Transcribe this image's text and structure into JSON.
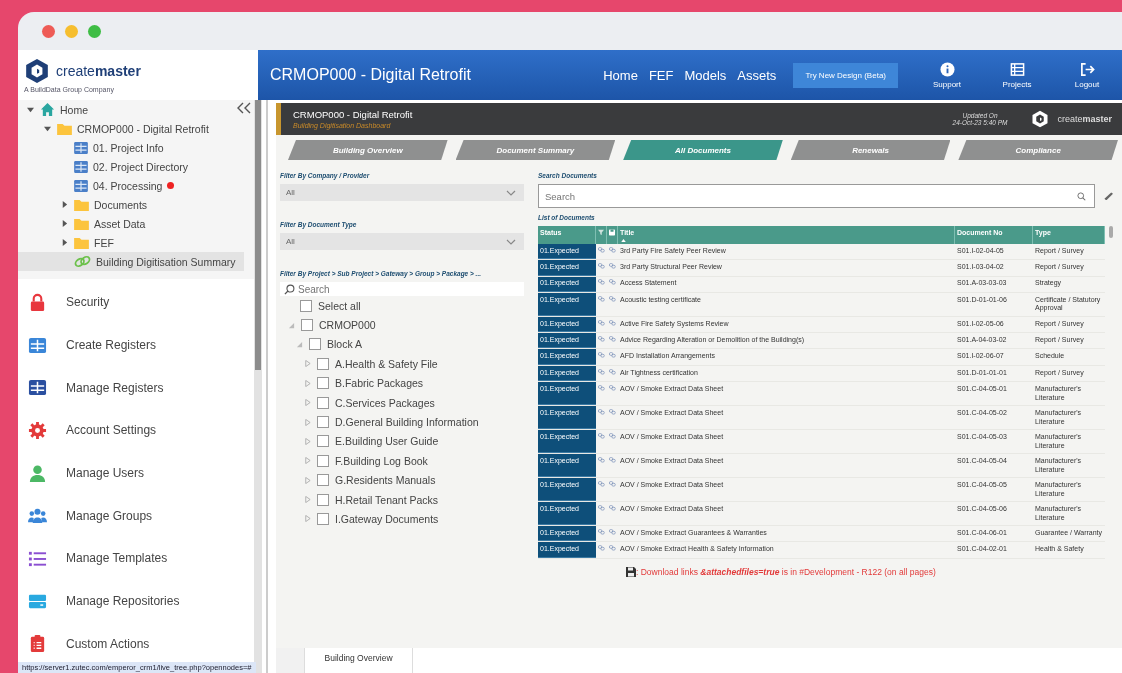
{
  "brand": {
    "logo": "create**master**",
    "tagline": "A BuildData Group Company"
  },
  "header": {
    "title": "CRMOP000 - Digital Retrofit",
    "nav": [
      "Home",
      "FEF",
      "Models",
      "Assets"
    ],
    "beta_button": "Try New Design (Beta)",
    "actions": [
      {
        "kind": "support",
        "label": "Support"
      },
      {
        "kind": "projects",
        "label": "Projects"
      },
      {
        "kind": "logout",
        "label": "Logout"
      }
    ]
  },
  "sidebar": {
    "tree": [
      {
        "kind": "home",
        "label": "Home",
        "expanded": true,
        "selected": false,
        "flagged": false,
        "children": [
          {
            "kind": "folder",
            "label": "CRMOP000 - Digital Retrofit",
            "expanded": true,
            "selected": false,
            "flagged": false,
            "children": [
              {
                "kind": "grid",
                "label": "01. Project Info",
                "selected": false,
                "flagged": false
              },
              {
                "kind": "grid",
                "label": "02. Project Directory",
                "selected": false,
                "flagged": false
              },
              {
                "kind": "grid",
                "label": "04. Processing",
                "selected": false,
                "flagged": true
              },
              {
                "kind": "folder",
                "label": "Documents",
                "expanded": false,
                "selected": false,
                "flagged": false
              },
              {
                "kind": "folder",
                "label": "Asset Data",
                "expanded": false,
                "selected": false,
                "flagged": false
              },
              {
                "kind": "folder",
                "label": "FEF",
                "expanded": false,
                "selected": false,
                "flagged": false
              },
              {
                "kind": "link",
                "label": "Building Digitisation Summary",
                "selected": true,
                "flagged": false
              }
            ]
          }
        ]
      }
    ],
    "menu": [
      {
        "kind": "security",
        "label": "Security"
      },
      {
        "kind": "create",
        "label": "Create Registers"
      },
      {
        "kind": "manage",
        "label": "Manage Registers"
      },
      {
        "kind": "settings",
        "label": "Account Settings"
      },
      {
        "kind": "user",
        "label": "Manage Users"
      },
      {
        "kind": "group",
        "label": "Manage Groups"
      },
      {
        "kind": "template",
        "label": "Manage Templates"
      },
      {
        "kind": "repository",
        "label": "Manage Repositories"
      },
      {
        "kind": "action",
        "label": "Custom Actions"
      }
    ]
  },
  "dashboard": {
    "title": "CRMOP000 - Digital Retrofit",
    "subtitle": "Building Digitisation Dashboard",
    "updated_label": "Updated On",
    "updated": "24-Oct-23 5:40 PM",
    "logo": "create**master**",
    "tabs": [
      {
        "label": "Building Overview",
        "selected": false
      },
      {
        "label": "Document Summary",
        "selected": false
      },
      {
        "label": "All Documents",
        "selected": true
      },
      {
        "label": "Renewals",
        "selected": false
      },
      {
        "label": "Compliance",
        "selected": false
      }
    ]
  },
  "filters": [
    {
      "label": "Filter By Company / Provider",
      "value": "All"
    },
    {
      "label": "Filter By Document Type",
      "value": "All"
    }
  ],
  "project_filter": {
    "label": "Filter By Project > Sub Project > Gateway > Group > Package > ...",
    "placeholder": "Search",
    "select_all": {
      "label": "Select all",
      "checked": false
    },
    "tree": [
      {
        "label": "CRMOP000",
        "checked": false,
        "expanded": true,
        "children": [
          {
            "label": "Block A",
            "checked": false,
            "expanded": true,
            "children": [
              {
                "label": "A.Health & Safety File",
                "checked": false,
                "expanded": false
              },
              {
                "label": "B.Fabric Packages",
                "checked": false,
                "expanded": false
              },
              {
                "label": "C.Services Packages",
                "checked": false,
                "expanded": false
              },
              {
                "label": "D.General Building Information",
                "checked": false,
                "expanded": false
              },
              {
                "label": "E.Building User Guide",
                "checked": false,
                "expanded": false
              },
              {
                "label": "F.Building Log Book",
                "checked": false,
                "expanded": false
              },
              {
                "label": "G.Residents Manuals",
                "checked": false,
                "expanded": false
              },
              {
                "label": "H.Retail Tenant Packs",
                "checked": false,
                "expanded": false
              },
              {
                "label": "I.Gateway Documents",
                "checked": false,
                "expanded": false
              }
            ]
          }
        ]
      }
    ]
  },
  "documents": {
    "search_label": "Search Documents",
    "search_placeholder": "Search",
    "list_label": "List of Documents",
    "columns": [
      {
        "label": "Status",
        "sorted": false
      },
      {
        "label": "Title",
        "sorted": true
      },
      {
        "label": "Document No",
        "sorted": false
      },
      {
        "label": "Type",
        "sorted": false
      }
    ],
    "rows": [
      {
        "status": "01.Expected",
        "title": "3rd Party Fire Safety Peer Review",
        "doc_no": "S01.I-02-04-05",
        "type": "Report / Survey"
      },
      {
        "status": "01.Expected",
        "title": "3rd Party Structural Peer Review",
        "doc_no": "S01.I-03-04-02",
        "type": "Report / Survey"
      },
      {
        "status": "01.Expected",
        "title": "Access Statement",
        "doc_no": "S01.A-03-03-03",
        "type": "Strategy"
      },
      {
        "status": "01.Expected",
        "title": "Acoustic testing certificate",
        "doc_no": "S01.D-01-01-06",
        "type": "Certificate / Statutory Approval"
      },
      {
        "status": "01.Expected",
        "title": "Active Fire Safety Systems Review",
        "doc_no": "S01.I-02-05-06",
        "type": "Report / Survey"
      },
      {
        "status": "01.Expected",
        "title": "Advice Regarding Alteration or Demolition of the Building(s)",
        "doc_no": "S01.A-04-03-02",
        "type": "Report / Survey"
      },
      {
        "status": "01.Expected",
        "title": "AFD Installation Arrangements",
        "doc_no": "S01.I-02-06-07",
        "type": "Schedule"
      },
      {
        "status": "01.Expected",
        "title": "Air Tightness certification",
        "doc_no": "S01.D-01-01-01",
        "type": "Report / Survey"
      },
      {
        "status": "01.Expected",
        "title": "AOV / Smoke Extract Data Sheet",
        "doc_no": "S01.C-04-05-01",
        "type": "Manufacturer's Literature"
      },
      {
        "status": "01.Expected",
        "title": "AOV / Smoke Extract Data Sheet",
        "doc_no": "S01.C-04-05-02",
        "type": "Manufacturer's Literature"
      },
      {
        "status": "01.Expected",
        "title": "AOV / Smoke Extract Data Sheet",
        "doc_no": "S01.C-04-05-03",
        "type": "Manufacturer's Literature"
      },
      {
        "status": "01.Expected",
        "title": "AOV / Smoke Extract Data Sheet",
        "doc_no": "S01.C-04-05-04",
        "type": "Manufacturer's Literature"
      },
      {
        "status": "01.Expected",
        "title": "AOV / Smoke Extract Data Sheet",
        "doc_no": "S01.C-04-05-05",
        "type": "Manufacturer's Literature"
      },
      {
        "status": "01.Expected",
        "title": "AOV / Smoke Extract Data Sheet",
        "doc_no": "S01.C-04-05-06",
        "type": "Manufacturer's Literature"
      },
      {
        "status": "01.Expected",
        "title": "AOV / Smoke Extract Guarantees & Warranties",
        "doc_no": "S01.C-04-06-01",
        "type": "Guarantee / Warranty"
      },
      {
        "status": "01.Expected",
        "title": "AOV / Smoke Extract Health & Safety Information",
        "doc_no": "S01.C-04-02-01",
        "type": "Health & Safety"
      }
    ],
    "note": ": Download links **&attachedfiles=true** is in #Development - R122 (on all pages)"
  },
  "bottom_tabs": [
    {
      "label": "Building Overview",
      "selected": true
    }
  ],
  "status_url": "https://server1.zutec.com/emperor_crm1/live_tree.php?opennodes=#"
}
